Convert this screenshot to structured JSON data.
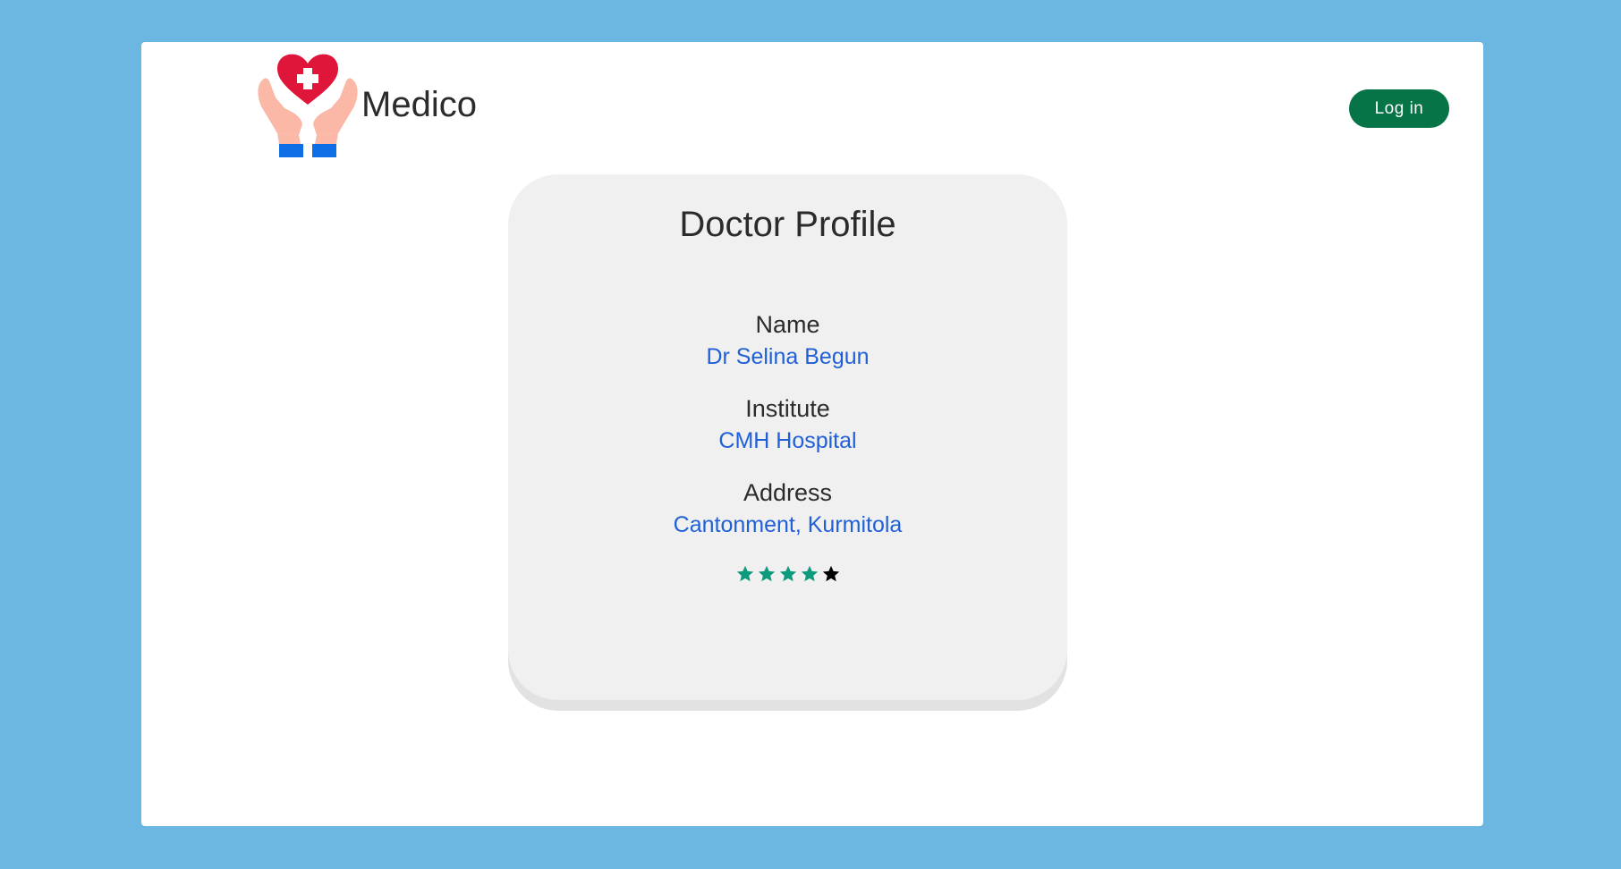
{
  "header": {
    "brand_name": "Medico",
    "login_label": "Log in",
    "logo_icon": "medical-hands-heart-icon"
  },
  "profile": {
    "title": "Doctor Profile",
    "fields": [
      {
        "label": "Name",
        "value": "Dr Selina Begun"
      },
      {
        "label": "Institute",
        "value": "CMH Hospital"
      },
      {
        "label": "Address",
        "value": "Cantonment, Kurmitola"
      }
    ],
    "rating": {
      "value": 4,
      "max": 5
    }
  },
  "colors": {
    "background": "#6cb6e2",
    "login_button": "#067446",
    "link_text": "#1f5fd8",
    "star_filled": "#0e9a7d",
    "star_empty": "#000000",
    "heart": "#e0153a"
  }
}
